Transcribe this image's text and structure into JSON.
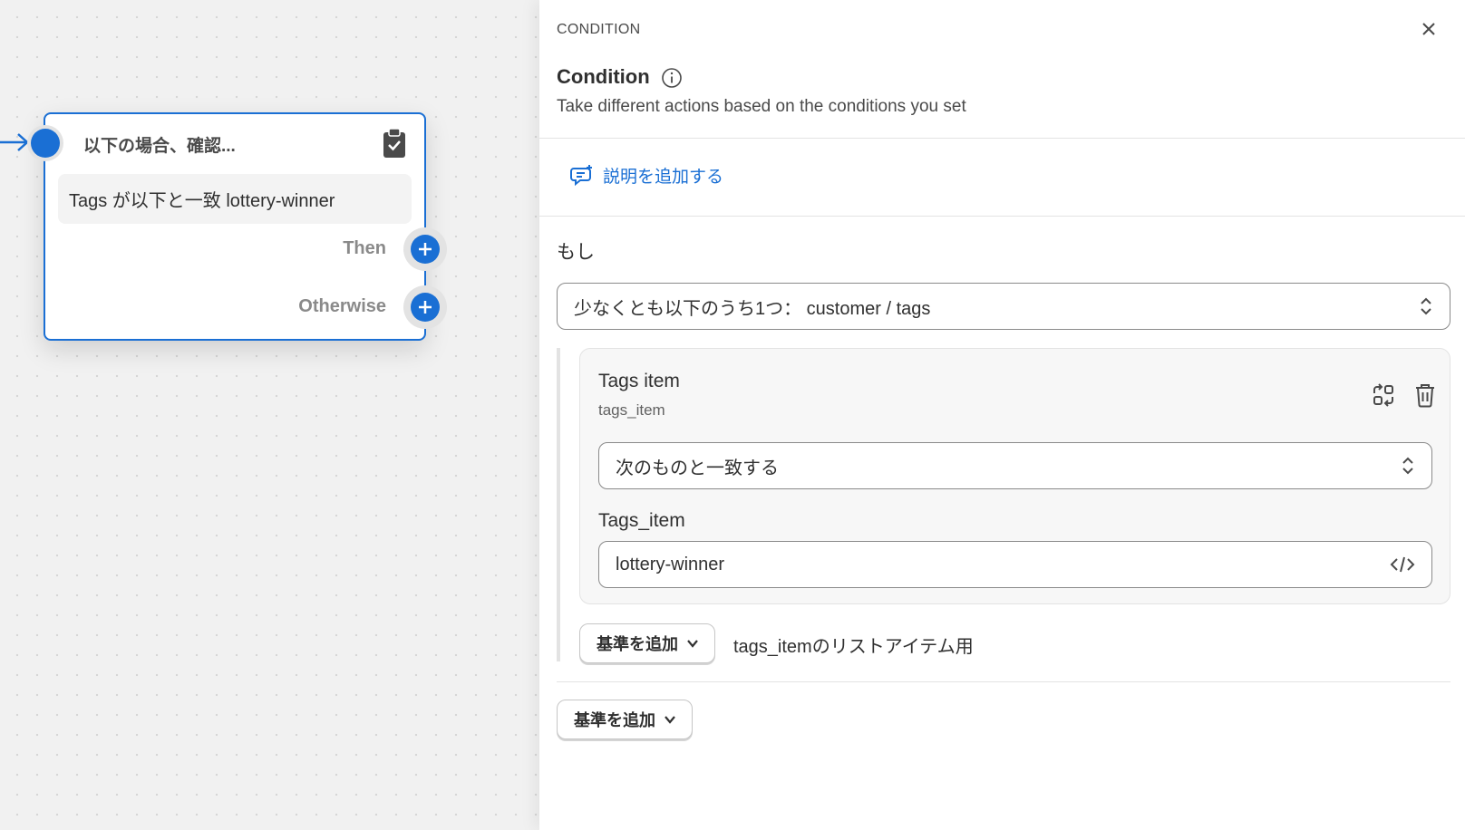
{
  "canvas": {
    "node": {
      "title": "以下の場合、確認...",
      "summary": "Tags が以下と一致 lottery-winner",
      "branches": {
        "then": "Then",
        "otherwise": "Otherwise"
      },
      "icons": {
        "clipboard": "clipboard-check-icon",
        "add": "plus-circle-icon"
      }
    }
  },
  "panel": {
    "eyebrow": "CONDITION",
    "title": "Condition",
    "subtitle": "Take different actions based on the conditions you set",
    "add_description": "説明を追加する",
    "if_label": "もし",
    "main_select": "少なくとも以下のうち1つ： customer / tags",
    "criteria": {
      "title": "Tags item",
      "key": "tags_item",
      "operator": "次のものと一致する",
      "value_label": "Tags_item",
      "value": "lottery-winner"
    },
    "inner_add_button": "基準を追加",
    "list_hint": "tags_itemのリストアイテム用",
    "outer_add_button": "基準を追加"
  },
  "colors": {
    "accent": "#1a6fd4",
    "border": "#8a8a8a",
    "text": "#303030"
  }
}
